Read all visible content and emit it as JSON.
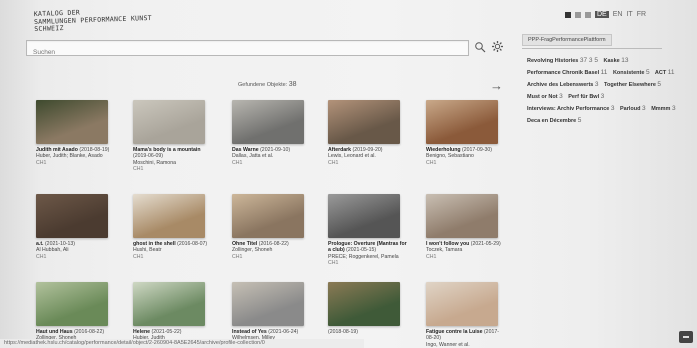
{
  "brand": {
    "line1": "KATALOG DER",
    "line2": "SAMMLUNGEN PERFORMANCE KUNST",
    "line3": "SCHWEIZ"
  },
  "languages": [
    "DE",
    "EN",
    "IT",
    "FR"
  ],
  "active_language": "DE",
  "search": {
    "placeholder": "Suchen",
    "value": ""
  },
  "results": {
    "label": "Gefundene Objekte:",
    "count": "38"
  },
  "facets": {
    "header": "PPP-FragPerformancePlattform",
    "items": [
      {
        "label": "Revolving Histories",
        "count": "37 3 5"
      },
      {
        "label": "Kaske",
        "count": "13"
      },
      {
        "label": "Performance Chronik Basel",
        "count": "11"
      },
      {
        "label": "Konsistente",
        "count": "5"
      },
      {
        "label": "ACT",
        "count": "11"
      },
      {
        "label": "Archive des Lebenswerts",
        "count": "3"
      },
      {
        "label": "Together Elsewhere",
        "count": "5"
      },
      {
        "label": "Must or Not",
        "count": "3"
      },
      {
        "label": "Perf für Bwl",
        "count": "3"
      },
      {
        "label": "Interviews: Archiv Performance",
        "count": "3"
      },
      {
        "label": "Parloud",
        "count": "3"
      },
      {
        "label": "Mmmm",
        "count": "3"
      },
      {
        "label": "Deca en Décembre",
        "count": "5"
      }
    ]
  },
  "cards": [
    {
      "title": "Judith mit Asado",
      "date": "(2018-08-19)",
      "author": "Huber, Judith; Blanke, Asado",
      "credit": "CH1",
      "colors": [
        "#8b7963",
        "#3e4a2e"
      ]
    },
    {
      "title": "Mama's body is a mountain",
      "date": "(2019-06-09)",
      "author": "Moschini, Ramona",
      "credit": "CH1",
      "colors": [
        "#a9a49a",
        "#cbc7bd"
      ]
    },
    {
      "title": "Das Warne",
      "date": "(2021-09-10)",
      "author": "Dallas, Jatta et al.",
      "credit": "CH1",
      "colors": [
        "#70706e",
        "#b8b6b0"
      ]
    },
    {
      "title": "Afterdark",
      "date": "(2019-09-20)",
      "author": "Lewis, Leonard et al.",
      "credit": "CH1",
      "colors": [
        "#685848",
        "#b3937a"
      ]
    },
    {
      "title": "Wiederholung",
      "date": "(2017-09-30)",
      "author": "Benigno, Sebastiano",
      "credit": "CH1",
      "colors": [
        "#8b5a3a",
        "#c9a98a"
      ]
    },
    {
      "title": "a.t.",
      "date": "(2021-10-13)",
      "author": "Al Hubbah, Ali",
      "credit": "CH1",
      "colors": [
        "#4b3b30",
        "#6d5848"
      ]
    },
    {
      "title": "ghost in the shell",
      "date": "(2016-08-07)",
      "author": "Hushi, Beatr",
      "credit": "CH1",
      "colors": [
        "#a88a66",
        "#e5ddd0"
      ]
    },
    {
      "title": "Ohne Titel",
      "date": "(2016-08-22)",
      "author": "Zollinger, Shoneh",
      "credit": "CH1",
      "colors": [
        "#8a7560",
        "#cdb79a"
      ]
    },
    {
      "title": "Prologue: Overture (Mantras for a club)",
      "date": "(2021-05-15)",
      "author": "PRECE; Roggenkerel, Pamela",
      "credit": "CH1",
      "colors": [
        "#555555",
        "#9a9a9a"
      ]
    },
    {
      "title": "I won't follow you",
      "date": "(2021-05-29)",
      "author": "Toczek, Tamara",
      "credit": "CH1",
      "colors": [
        "#8f7c6b",
        "#c9bfb3"
      ]
    },
    {
      "title": "Haut und Haus",
      "date": "(2016-08-22)",
      "author": "Zollinger, Shoneh",
      "credit": "",
      "colors": [
        "#6a8a58",
        "#b2c29d"
      ]
    },
    {
      "title": "Helene",
      "date": "(2021-05-22)",
      "author": "Hubier, Judith",
      "credit": "",
      "colors": [
        "#6c8a62",
        "#cfd8c4"
      ]
    },
    {
      "title": "Instead of Yes",
      "date": "(2021-06-24)",
      "author": "Wilhelmsen, Milley",
      "credit": "",
      "colors": [
        "#8a8a8a",
        "#c6c0b5"
      ]
    },
    {
      "title": "",
      "date": "(2018-08-19)",
      "author": "",
      "credit": "",
      "colors": [
        "#3f5a38",
        "#8b7a55"
      ]
    },
    {
      "title": "Fatigue contre la Luise",
      "date": "(2017-08-20)",
      "author": "Ingo, Wanner et al.",
      "credit": "",
      "colors": [
        "#c7a98f",
        "#e0d4c6"
      ]
    }
  ],
  "status_url": "https://mediathek.hslu.ch/catalog/performance/detail/object/2-260904-8A5E2645/archive/profile-collection/0"
}
